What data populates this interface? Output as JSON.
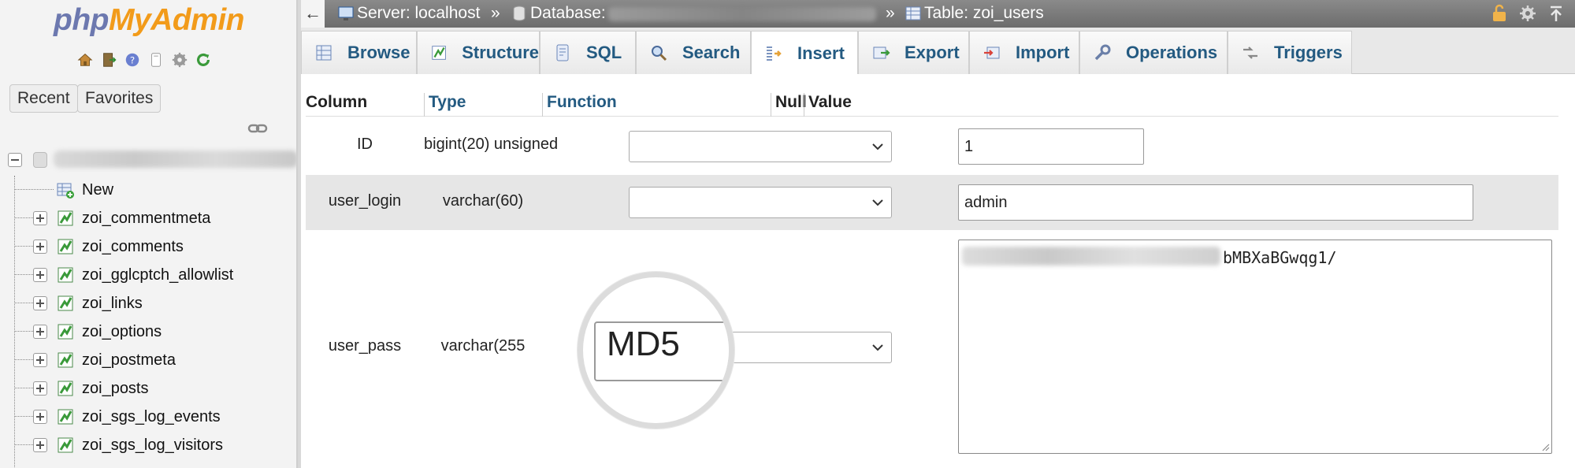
{
  "logo": {
    "part1": "php",
    "part2": "MyAdmin"
  },
  "sidebar": {
    "nav_icons": [
      "home-icon",
      "exit-icon",
      "help-icon",
      "docs-icon",
      "settings-icon",
      "reload-icon"
    ],
    "recent_label": "Recent",
    "favorites_label": "Favorites",
    "tree": {
      "new_label": "New",
      "tables": [
        "zoi_commentmeta",
        "zoi_comments",
        "zoi_gglcptch_allowlist",
        "zoi_links",
        "zoi_options",
        "zoi_postmeta",
        "zoi_posts",
        "zoi_sgs_log_events",
        "zoi_sgs_log_visitors"
      ]
    }
  },
  "breadcrumb": {
    "back": "←",
    "server": "Server: localhost",
    "sep": "»",
    "database": "Database:",
    "table": "Table: zoi_users"
  },
  "tabs": [
    {
      "label": "Browse",
      "icon": "browse-icon"
    },
    {
      "label": "Structure",
      "icon": "structure-icon"
    },
    {
      "label": "SQL",
      "icon": "sql-icon"
    },
    {
      "label": "Search",
      "icon": "search-icon"
    },
    {
      "label": "Insert",
      "icon": "insert-icon",
      "active": true
    },
    {
      "label": "Export",
      "icon": "export-icon"
    },
    {
      "label": "Import",
      "icon": "import-icon"
    },
    {
      "label": "Operations",
      "icon": "operations-icon"
    },
    {
      "label": "Triggers",
      "icon": "triggers-icon"
    }
  ],
  "table": {
    "headers": {
      "column": "Column",
      "type": "Type",
      "function": "Function",
      "null": "Null",
      "value": "Value"
    },
    "rows": [
      {
        "column": "ID",
        "type": "bigint(20) unsigned",
        "function": "",
        "value": "1"
      },
      {
        "column": "user_login",
        "type": "varchar(60)",
        "function": "",
        "value": "admin"
      },
      {
        "column": "user_pass",
        "type": "varchar(255",
        "function": "MD5",
        "value_visible": "bMBXaBGwqg1/"
      }
    ]
  }
}
